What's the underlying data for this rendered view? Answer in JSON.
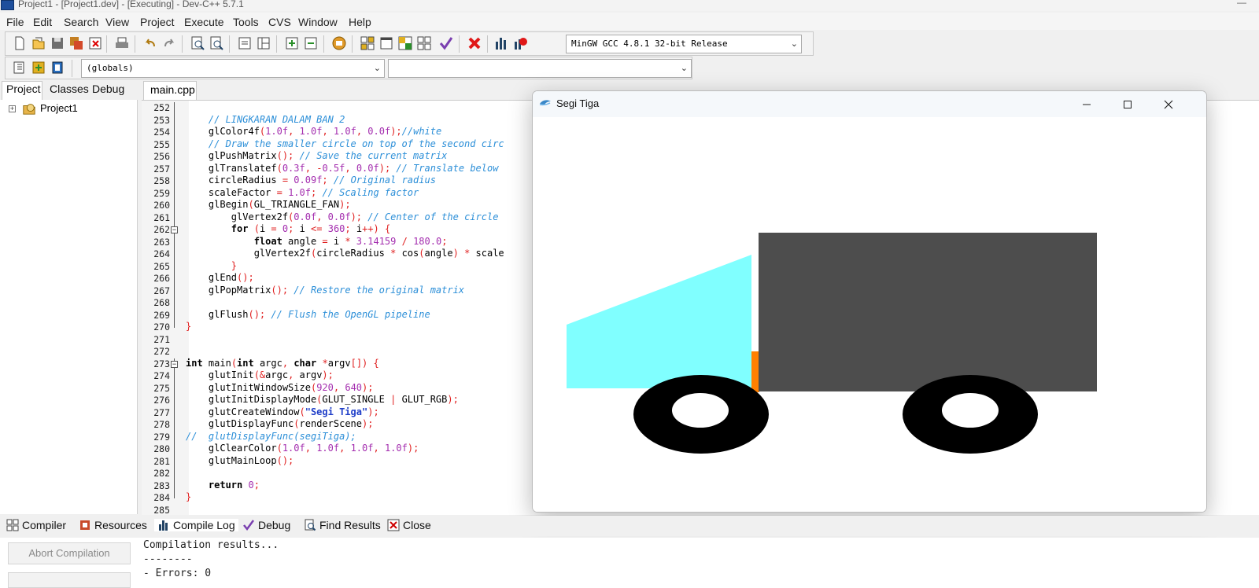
{
  "window": {
    "title": "Project1 - [Project1.dev] - [Executing] - Dev-C++ 5.7.1"
  },
  "menu": [
    "File",
    "Edit",
    "Search",
    "View",
    "Project",
    "Execute",
    "Tools",
    "CVS",
    "Window",
    "Help"
  ],
  "toolbar": {
    "compiler_select": "MinGW GCC 4.8.1 32-bit Release",
    "scope_select": "(globals)",
    "member_select": ""
  },
  "left_panel": {
    "tabs": [
      "Project",
      "Classes",
      "Debug"
    ],
    "active_tab": "Project",
    "tree_root": "Project1"
  },
  "editor": {
    "active_tab": "main.cpp",
    "lines": [
      {
        "n": "252",
        "html": ""
      },
      {
        "n": "253",
        "html": "    <span class=\"c-com\">// LINGKARAN DALAM BAN 2</span>"
      },
      {
        "n": "254",
        "html": "    glColor4f<span class=\"c-op\">(</span><span class=\"c-num\">1.0f</span><span class=\"c-op\">,</span> <span class=\"c-num\">1.0f</span><span class=\"c-op\">,</span> <span class=\"c-num\">1.0f</span><span class=\"c-op\">,</span> <span class=\"c-num\">0.0f</span><span class=\"c-op\">);</span><span class=\"c-com\">//white</span>"
      },
      {
        "n": "255",
        "html": "    <span class=\"c-com\">// Draw the smaller circle on top of the second circ</span>"
      },
      {
        "n": "256",
        "html": "    glPushMatrix<span class=\"c-op\">();</span> <span class=\"c-com\">// Save the current matrix</span>"
      },
      {
        "n": "257",
        "html": "    glTranslatef<span class=\"c-op\">(</span><span class=\"c-num\">0.3f</span><span class=\"c-op\">,</span> <span class=\"c-op\">-</span><span class=\"c-num\">0.5f</span><span class=\"c-op\">,</span> <span class=\"c-num\">0.0f</span><span class=\"c-op\">);</span> <span class=\"c-com\">// Translate below</span>"
      },
      {
        "n": "258",
        "html": "    circleRadius <span class=\"c-op\">=</span> <span class=\"c-num\">0.09f</span><span class=\"c-op\">;</span> <span class=\"c-com\">// Original radius</span>"
      },
      {
        "n": "259",
        "html": "    scaleFactor <span class=\"c-op\">=</span> <span class=\"c-num\">1.0f</span><span class=\"c-op\">;</span> <span class=\"c-com\">// Scaling factor</span>"
      },
      {
        "n": "260",
        "html": "    glBegin<span class=\"c-op\">(</span>GL_TRIANGLE_FAN<span class=\"c-op\">);</span>"
      },
      {
        "n": "261",
        "html": "        glVertex2f<span class=\"c-op\">(</span><span class=\"c-num\">0.0f</span><span class=\"c-op\">,</span> <span class=\"c-num\">0.0f</span><span class=\"c-op\">);</span> <span class=\"c-com\">// Center of the circle</span>"
      },
      {
        "n": "262",
        "html": "        <span class=\"c-kw\">for</span> <span class=\"c-op\">(</span>i <span class=\"c-op\">=</span> <span class=\"c-num\">0</span><span class=\"c-op\">;</span> i <span class=\"c-op\">&lt;=</span> <span class=\"c-num\">360</span><span class=\"c-op\">;</span> i<span class=\"c-op\">++)</span> <span class=\"c-op\">{</span>"
      },
      {
        "n": "263",
        "html": "            <span class=\"c-kw\">float</span> angle <span class=\"c-op\">=</span> i <span class=\"c-op\">*</span> <span class=\"c-num\">3.14159</span> <span class=\"c-op\">/</span> <span class=\"c-num\">180.0</span><span class=\"c-op\">;</span>"
      },
      {
        "n": "264",
        "html": "            glVertex2f<span class=\"c-op\">(</span>circleRadius <span class=\"c-op\">*</span> cos<span class=\"c-op\">(</span>angle<span class=\"c-op\">)</span> <span class=\"c-op\">*</span> scale"
      },
      {
        "n": "265",
        "html": "        <span class=\"c-op\">}</span>"
      },
      {
        "n": "266",
        "html": "    glEnd<span class=\"c-op\">();</span>"
      },
      {
        "n": "267",
        "html": "    glPopMatrix<span class=\"c-op\">();</span> <span class=\"c-com\">// Restore the original matrix</span>"
      },
      {
        "n": "268",
        "html": ""
      },
      {
        "n": "269",
        "html": "    glFlush<span class=\"c-op\">();</span> <span class=\"c-com\">// Flush the OpenGL pipeline</span>"
      },
      {
        "n": "270",
        "html": "<span class=\"c-op\">}</span>"
      },
      {
        "n": "271",
        "html": ""
      },
      {
        "n": "272",
        "html": ""
      },
      {
        "n": "273",
        "html": "<span class=\"c-kw\">int</span> main<span class=\"c-op\">(</span><span class=\"c-kw\">int</span> argc<span class=\"c-op\">,</span> <span class=\"c-kw\">char</span> <span class=\"c-op\">*</span>argv<span class=\"c-op\">[])</span> <span class=\"c-op\">{</span>"
      },
      {
        "n": "274",
        "html": "    glutInit<span class=\"c-op\">(&amp;</span>argc<span class=\"c-op\">,</span> argv<span class=\"c-op\">);</span>"
      },
      {
        "n": "275",
        "html": "    glutInitWindowSize<span class=\"c-op\">(</span><span class=\"c-num\">920</span><span class=\"c-op\">,</span> <span class=\"c-num\">640</span><span class=\"c-op\">);</span>"
      },
      {
        "n": "276",
        "html": "    glutInitDisplayMode<span class=\"c-op\">(</span>GLUT_SINGLE <span class=\"c-op\">|</span> GLUT_RGB<span class=\"c-op\">);</span>"
      },
      {
        "n": "277",
        "html": "    glutCreateWindow<span class=\"c-op\">(</span><span class=\"c-str\">\"Segi Tiga\"</span><span class=\"c-op\">);</span>"
      },
      {
        "n": "278",
        "html": "    glutDisplayFunc<span class=\"c-op\">(</span>renderScene<span class=\"c-op\">);</span>"
      },
      {
        "n": "279",
        "html": "<span class=\"c-com\">//  glutDisplayFunc(segiTiga);</span>"
      },
      {
        "n": "280",
        "html": "    glClearColor<span class=\"c-op\">(</span><span class=\"c-num\">1.0f</span><span class=\"c-op\">,</span> <span class=\"c-num\">1.0f</span><span class=\"c-op\">,</span> <span class=\"c-num\">1.0f</span><span class=\"c-op\">,</span> <span class=\"c-num\">1.0f</span><span class=\"c-op\">);</span>"
      },
      {
        "n": "281",
        "html": "    glutMainLoop<span class=\"c-op\">();</span>"
      },
      {
        "n": "282",
        "html": ""
      },
      {
        "n": "283",
        "html": "    <span class=\"c-kw\">return</span> <span class=\"c-num\">0</span><span class=\"c-op\">;</span>"
      },
      {
        "n": "284",
        "html": "<span class=\"c-op\">}</span>"
      },
      {
        "n": "285",
        "html": ""
      }
    ]
  },
  "bottom": {
    "tabs": [
      "Compiler",
      "Resources",
      "Compile Log",
      "Debug",
      "Find Results",
      "Close"
    ],
    "abort_label": "Abort Compilation",
    "log": [
      "Compilation results...",
      "--------",
      "- Errors: 0"
    ]
  },
  "glut_window": {
    "title": "Segi Tiga"
  },
  "colors": {
    "cabin": "#80ffff",
    "cargo": "#4d4d4d",
    "bumper": "#ff8000",
    "tire": "#000000",
    "hub": "#ffffff"
  }
}
